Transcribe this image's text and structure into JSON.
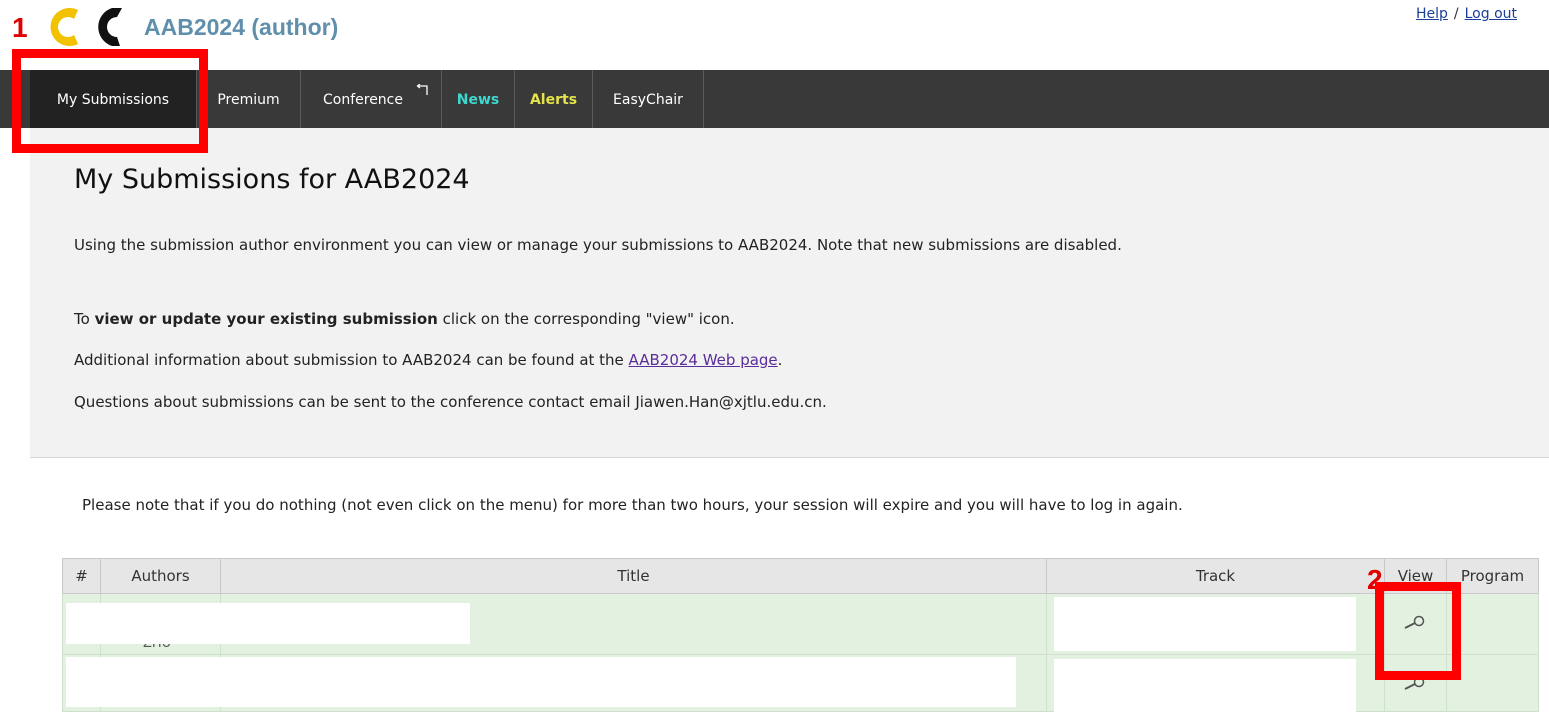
{
  "header": {
    "app_title": "AAB2024 (author)",
    "help_label": "Help",
    "separator": "/",
    "logout_label": "Log out"
  },
  "annotations": {
    "step1": "1",
    "step2": "2",
    "color": "#ff0000"
  },
  "menu": {
    "items": [
      {
        "label": "My Submissions"
      },
      {
        "label": "Premium"
      },
      {
        "label": "Conference"
      },
      {
        "label": "News"
      },
      {
        "label": "Alerts"
      },
      {
        "label": "EasyChair"
      }
    ]
  },
  "main": {
    "title": "My Submissions for AAB2024",
    "para1": "Using the submission author environment you can view or manage your submissions to AAB2024. Note that new submissions are disabled.",
    "para2_prefix": "To ",
    "para2_bold": "view or update your existing submission",
    "para2_suffix": " click on the corresponding \"view\" icon.",
    "para3_prefix": "Additional information about submission to AAB2024 can be found at the ",
    "para3_link": "AAB2024 Web page",
    "para3_suffix": ".",
    "para4": "Questions about submissions can be sent to the conference contact email Jiawen.Han@xjtlu.edu.cn."
  },
  "session_note": "Please note that if you do nothing (not even click on the menu) for more than two hours, your session will expire and you will have to log in again.",
  "table": {
    "headers": [
      "#",
      "Authors",
      "Title",
      "Track",
      "View",
      "Program"
    ],
    "row1_partial_text": "ZHU"
  },
  "icons": [
    "easychair-logo-icon",
    "external-link-icon",
    "magnifier-view-icon"
  ],
  "colors": {
    "menu_bg": "#393939",
    "news": "#3fd8cf",
    "alerts": "#e6e24a",
    "title_blue": "#5f8faa",
    "row_green": "#e3f1e1"
  }
}
